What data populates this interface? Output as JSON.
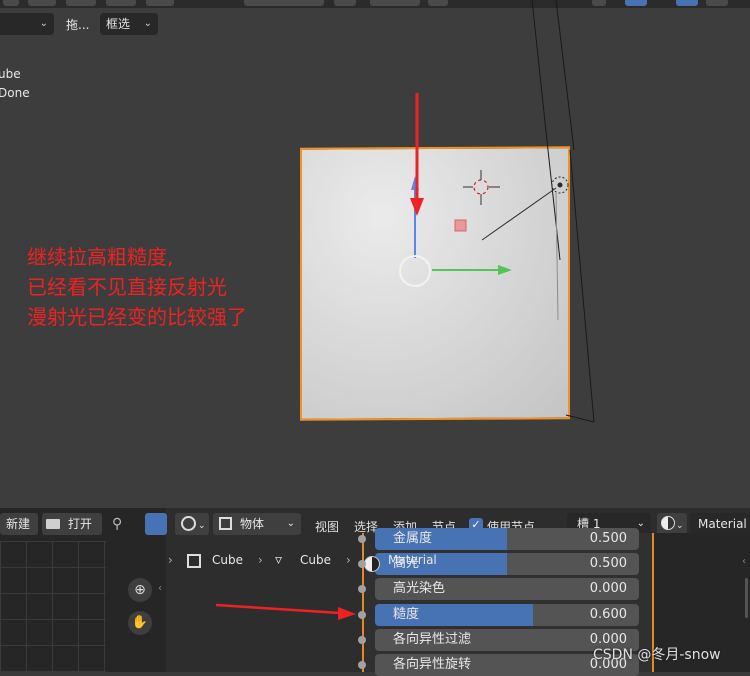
{
  "viewport": {
    "toolbar": {
      "mode_dropdown_partial": "",
      "drag_label": "拖...",
      "select_mode": "框选"
    },
    "overlay_lines": [
      "ube",
      "Done"
    ],
    "annotation_lines": [
      "继续拉高粗糙度,",
      "已经看不见直接反射光",
      "漫射光已经变的比较强了"
    ]
  },
  "editor": {
    "toolbar": {
      "new_label": "新建",
      "open_label": "打开",
      "object_label": "物体",
      "menus": [
        "视图",
        "选择",
        "添加",
        "节点"
      ],
      "use_nodes_label": "使用节点",
      "use_nodes_checked": true,
      "slot_label": "槽 1",
      "material_label": "Material"
    },
    "breadcrumb": {
      "object": "Cube",
      "mesh": "Cube",
      "material": "Material"
    },
    "properties": [
      {
        "label": "金属度",
        "value": "0.500",
        "fraction": 0.5
      },
      {
        "label": "高光",
        "value": "0.500",
        "fraction": 0.5
      },
      {
        "label": "高光染色",
        "value": "0.000",
        "fraction": 0.0
      },
      {
        "label": "糙度",
        "value": "0.600",
        "fraction": 0.6
      },
      {
        "label": "各向异性过滤",
        "value": "0.000",
        "fraction": 0.0
      },
      {
        "label": "各向异性旋转",
        "value": "0.000",
        "fraction": 0.0
      }
    ],
    "watermark": "CSDN @冬月-snow"
  },
  "colors": {
    "annotation_red": "#ee2222",
    "selection_orange": "#f0922a",
    "slider_blue": "#4772b3",
    "gizmo_green": "#55c455",
    "gizmo_blue": "#4f7ad6"
  }
}
